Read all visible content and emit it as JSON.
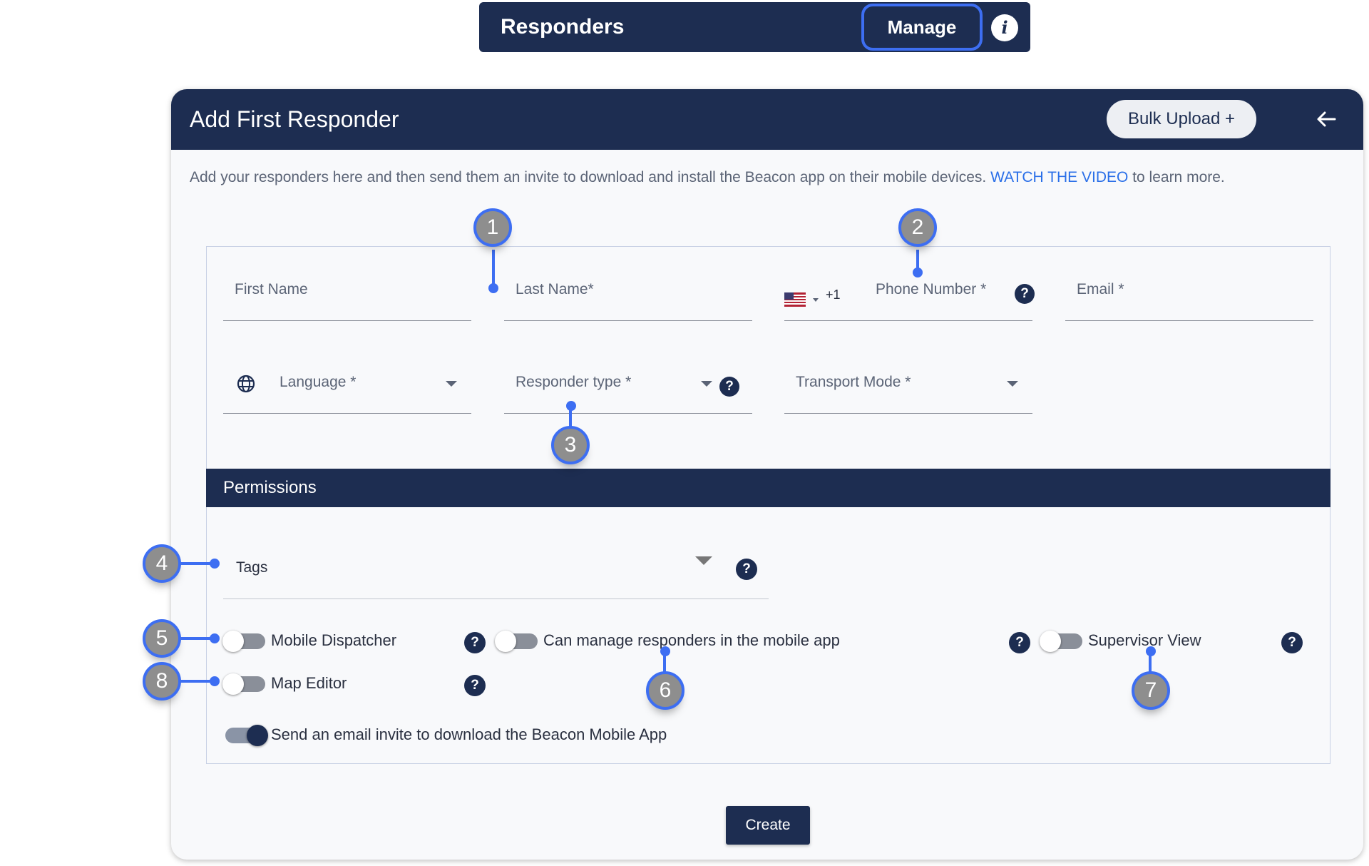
{
  "topbar": {
    "title": "Responders",
    "manage_label": "Manage",
    "info_icon": "info-icon"
  },
  "card": {
    "title": "Add First Responder",
    "bulk_upload_label": "Bulk Upload +",
    "intro_before": "Add your responders here and then send them an invite to download and install the Beacon app on their mobile devices. ",
    "intro_link": "WATCH THE VIDEO",
    "intro_after": " to learn more."
  },
  "fields": {
    "first_name": "First Name",
    "last_name": "Last Name*",
    "phone_code": "+1",
    "phone": "Phone Number *",
    "email": "Email *",
    "language": "Language *",
    "responder_type": "Responder type *",
    "transport_mode": "Transport Mode *"
  },
  "permissions": {
    "title": "Permissions",
    "tags": "Tags",
    "mobile_dispatcher": "Mobile Dispatcher",
    "can_manage": "Can manage responders in the mobile app",
    "supervisor_view": "Supervisor View",
    "map_editor": "Map Editor",
    "email_invite": "Send an email invite to download the Beacon Mobile App"
  },
  "toggles": {
    "mobile_dispatcher": false,
    "can_manage": false,
    "supervisor_view": false,
    "map_editor": false,
    "email_invite": true
  },
  "create_label": "Create",
  "callouts": [
    "1",
    "2",
    "3",
    "4",
    "5",
    "6",
    "7",
    "8"
  ],
  "colors": {
    "navy": "#1d2d51",
    "accent": "#3d6ef2",
    "link": "#2a6fe8"
  }
}
